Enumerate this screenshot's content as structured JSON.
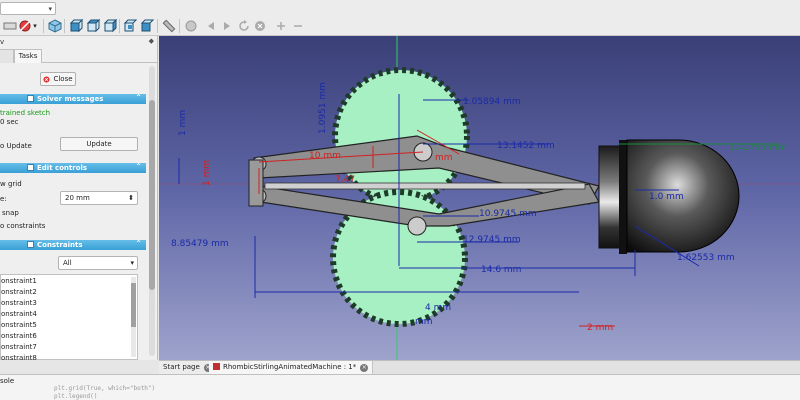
{
  "panel": {
    "header_fragment": "v",
    "tabs": [
      "",
      "Tasks"
    ],
    "close_label": "Close",
    "solver": {
      "title": "Solver messages",
      "status": "trained sketch",
      "time": "0 sec",
      "auto_update_label": "o Update",
      "update_button": "Update"
    },
    "edit": {
      "title": "Edit controls",
      "show_grid": "w grid",
      "grid_size_label": "e:",
      "grid_size_value": "20 mm",
      "grid_snap": "snap",
      "auto_constraints": "o constraints"
    },
    "constraints": {
      "title": "Constraints",
      "filter": "All",
      "items": [
        "onstraint1",
        "onstraint2",
        "onstraint3",
        "onstraint4",
        "onstraint5",
        "onstraint6",
        "onstraint7",
        "onstraint8"
      ]
    }
  },
  "view": {
    "dims_blue": [
      "1.05894 mm",
      "13.1452 mm",
      "10.9745 mm",
      "12.9745 mm",
      "14.6 mm",
      "1.62553 mm",
      "8.85479 mm",
      "1 mm",
      "1.0951 mm",
      "1.0 mm",
      "4 mm",
      "mm"
    ],
    "dims_red": [
      "10 mm",
      "1 mm",
      "2 mm",
      "7.47",
      "mm"
    ],
    "dims_green": [
      "1.42755 mm"
    ]
  },
  "doc_tabs": [
    "Start page",
    "RhombicStirlingAnimatedMachine : 1*"
  ],
  "console": {
    "title": "sole",
    "lines": [
      "plt.grid(True, which=\"both\")",
      "plt.legend()"
    ]
  },
  "colors": {
    "accent": "#3a9fd6",
    "gear": "#a6f0c4",
    "dim_blue": "#1a2aa8",
    "dim_red": "#d22020"
  }
}
